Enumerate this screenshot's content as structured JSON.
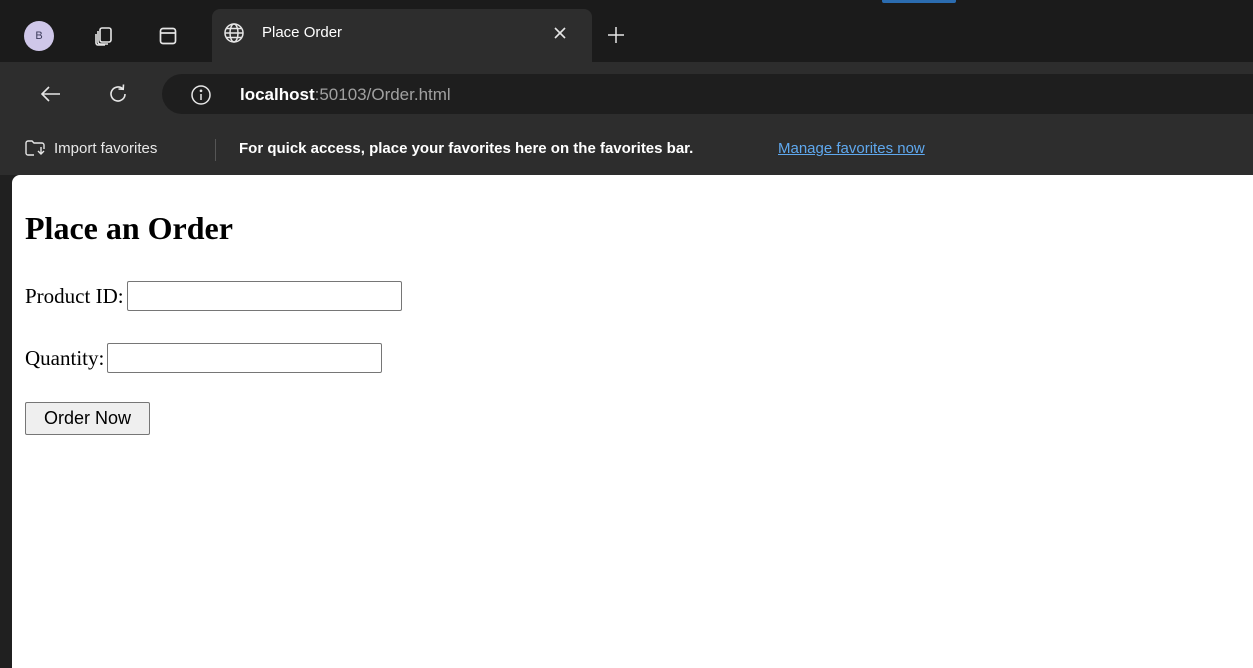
{
  "browser": {
    "profile_initial": "B",
    "tab": {
      "title": "Place Order"
    },
    "address": {
      "host": "localhost",
      "rest": ":50103/Order.html"
    },
    "favorites_bar": {
      "import_label": "Import favorites",
      "message": "For quick access, place your favorites here on the favorites bar.",
      "manage_link": "Manage favorites now"
    },
    "icons": {
      "tab_actions": "tab-actions-icon",
      "vertical_tabs": "vertical-tabs-icon",
      "globe": "globe-icon",
      "close": "close-icon",
      "new_tab": "plus-icon",
      "back": "back-arrow-icon",
      "refresh": "refresh-icon",
      "site_info": "info-icon",
      "import": "import-favorites-icon"
    },
    "colors": {
      "tabstrip_bg": "#1b1b1b",
      "toolbar_bg": "#2d2d2d",
      "link": "#5fa8ee",
      "profile_bg": "#cfc7e9"
    }
  },
  "page": {
    "heading": "Place an Order",
    "product_id": {
      "label": "Product ID:",
      "value": ""
    },
    "quantity": {
      "label": "Quantity:",
      "value": ""
    },
    "submit_label": "Order Now"
  }
}
